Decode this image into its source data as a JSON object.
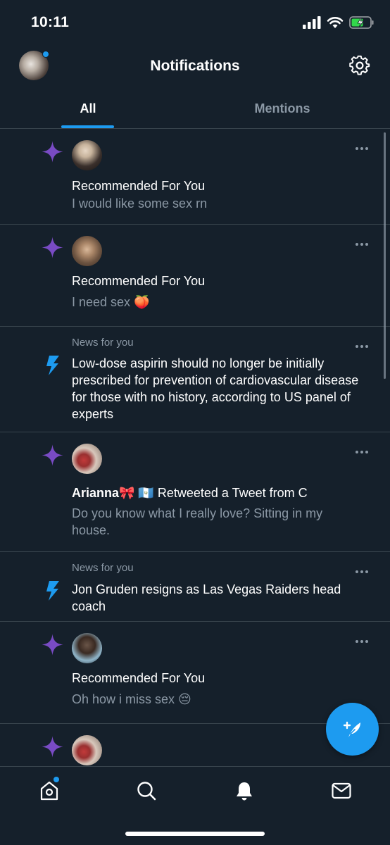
{
  "status": {
    "time": "10:11"
  },
  "header": {
    "title": "Notifications"
  },
  "tabs": [
    {
      "label": "All",
      "active": true
    },
    {
      "label": "Mentions",
      "active": false
    }
  ],
  "feed": [
    {
      "type": "recommended",
      "icon": "sparkle-icon",
      "title": "Recommended For You",
      "text": "I would like some sex rn"
    },
    {
      "type": "recommended",
      "icon": "sparkle-icon",
      "title": "Recommended For You",
      "text": "I need sex 🍑"
    },
    {
      "type": "news",
      "icon": "lightning-icon",
      "label": "News for you",
      "text": "Low-dose aspirin should no longer be initially prescribed for prevention of cardiovascular disease for those with no history, according to US panel of experts"
    },
    {
      "type": "retweet",
      "icon": "sparkle-icon",
      "user": "Arianna🎀 🇬🇹",
      "action": " Retweeted a Tweet from C",
      "text": "Do you know what I really love? Sitting in my house."
    },
    {
      "type": "news",
      "icon": "lightning-icon",
      "label": "News for you",
      "text": "Jon Gruden resigns as Las Vegas Raiders head coach"
    },
    {
      "type": "recommended",
      "icon": "sparkle-icon",
      "title": "Recommended For You",
      "text": "Oh how i miss sex 😔"
    }
  ],
  "colors": {
    "accent": "#1d9bf0",
    "background": "#15202b",
    "sparkle": "#794bc4",
    "muted": "#8b98a5",
    "divider": "#38444d"
  }
}
